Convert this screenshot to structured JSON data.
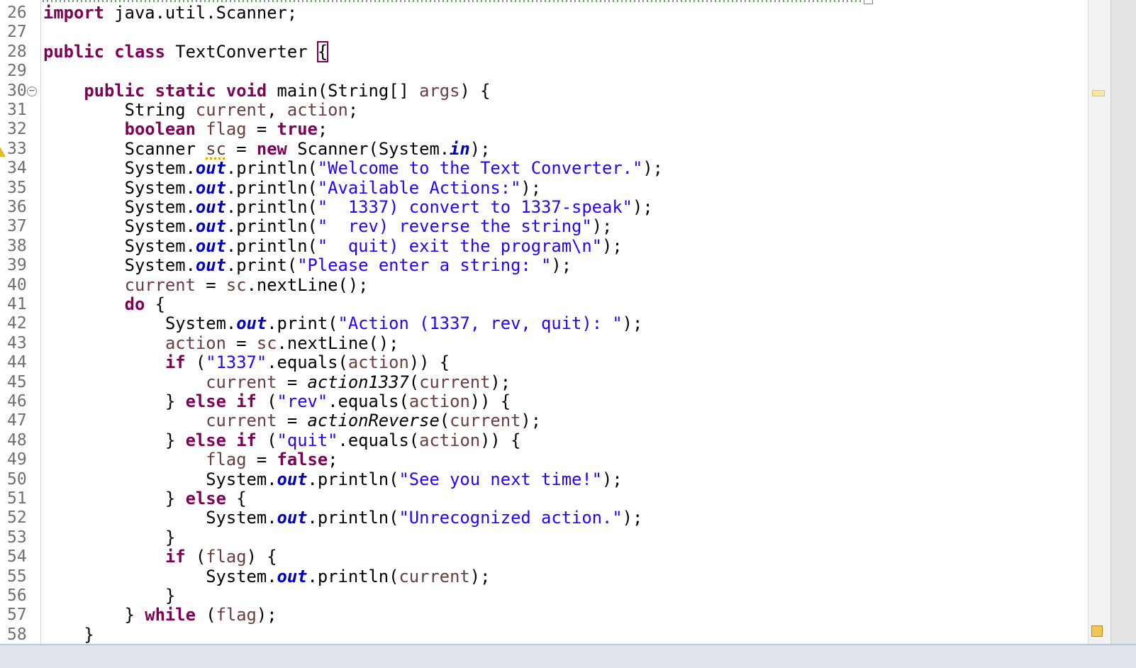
{
  "editor": {
    "line_numbers": [
      "26",
      "27",
      "28",
      "29",
      "30",
      "31",
      "32",
      "33",
      "34",
      "35",
      "36",
      "37",
      "38",
      "39",
      "40",
      "41",
      "42",
      "43",
      "44",
      "45",
      "46",
      "47",
      "48",
      "49",
      "50",
      "51",
      "52",
      "53",
      "54",
      "55",
      "56",
      "57",
      "58"
    ],
    "fold_glyph": "−",
    "code": {
      "l26": {
        "kw": "import",
        "rest": " java.util.Scanner;"
      },
      "l28": {
        "kw1": "public",
        "kw2": "class",
        "name": " TextConverter ",
        "brace": "{"
      },
      "l30": {
        "indent": "    ",
        "kw1": "public",
        "kw2": "static",
        "kw3": "void",
        "sig": " main(String[] ",
        "param": "args",
        "end": ") {"
      },
      "l31": {
        "indent": "        ",
        "type": "String ",
        "v1": "current",
        "comma": ", ",
        "v2": "action",
        "end": ";"
      },
      "l32": {
        "indent": "        ",
        "kw": "boolean",
        "sp": " ",
        "var": "flag",
        "eq": " = ",
        "val": "true",
        "end": ";"
      },
      "l33": {
        "indent": "        ",
        "type": "Scanner ",
        "var": "sc",
        "eq": " = ",
        "kw": "new",
        "call": " Scanner(System.",
        "fld": "in",
        "end": ");"
      },
      "l34": {
        "indent": "        ",
        "obj": "System.",
        "fld": "out",
        "method": ".println(",
        "str": "\"Welcome to the Text Converter.\"",
        "end": ");"
      },
      "l35": {
        "indent": "        ",
        "obj": "System.",
        "fld": "out",
        "method": ".println(",
        "str": "\"Available Actions:\"",
        "end": ");"
      },
      "l36": {
        "indent": "        ",
        "obj": "System.",
        "fld": "out",
        "method": ".println(",
        "str": "\"  1337) convert to 1337-speak\"",
        "end": ");"
      },
      "l37": {
        "indent": "        ",
        "obj": "System.",
        "fld": "out",
        "method": ".println(",
        "str": "\"  rev) reverse the string\"",
        "end": ");"
      },
      "l38": {
        "indent": "        ",
        "obj": "System.",
        "fld": "out",
        "method": ".println(",
        "str": "\"  quit) exit the program\\n\"",
        "end": ");"
      },
      "l39": {
        "indent": "        ",
        "obj": "System.",
        "fld": "out",
        "method": ".print(",
        "str": "\"Please enter a string: \"",
        "end": ");"
      },
      "l40": {
        "indent": "        ",
        "var": "current",
        "eq": " = ",
        "var2": "sc",
        "call": ".nextLine();"
      },
      "l41": {
        "indent": "        ",
        "kw": "do",
        "end": " {"
      },
      "l42": {
        "indent": "            ",
        "obj": "System.",
        "fld": "out",
        "method": ".print(",
        "str": "\"Action (1337, rev, quit): \"",
        "end": ");"
      },
      "l43": {
        "indent": "            ",
        "var": "action",
        "eq": " = ",
        "var2": "sc",
        "call": ".nextLine();"
      },
      "l44": {
        "indent": "            ",
        "kw": "if",
        "open": " (",
        "str": "\"1337\"",
        "call": ".equals(",
        "var": "action",
        "end": ")) {"
      },
      "l45": {
        "indent": "                ",
        "var": "current",
        "eq": " = ",
        "method": "action1337",
        "open": "(",
        "var2": "current",
        "end": ");"
      },
      "l46": {
        "indent": "            ",
        "close": "} ",
        "kw1": "else",
        "sp": " ",
        "kw2": "if",
        "open": " (",
        "str": "\"rev\"",
        "call": ".equals(",
        "var": "action",
        "end": ")) {"
      },
      "l47": {
        "indent": "                ",
        "var": "current",
        "eq": " = ",
        "method": "actionReverse",
        "open": "(",
        "var2": "current",
        "end": ");"
      },
      "l48": {
        "indent": "            ",
        "close": "} ",
        "kw1": "else",
        "sp": " ",
        "kw2": "if",
        "open": " (",
        "str": "\"quit\"",
        "call": ".equals(",
        "var": "action",
        "end": ")) {"
      },
      "l49": {
        "indent": "                ",
        "var": "flag",
        "eq": " = ",
        "val": "false",
        "end": ";"
      },
      "l50": {
        "indent": "                ",
        "obj": "System.",
        "fld": "out",
        "method": ".println(",
        "str": "\"See you next time!\"",
        "end": ");"
      },
      "l51": {
        "indent": "            ",
        "close": "} ",
        "kw": "else",
        "end": " {"
      },
      "l52": {
        "indent": "                ",
        "obj": "System.",
        "fld": "out",
        "method": ".println(",
        "str": "\"Unrecognized action.\"",
        "end": ");"
      },
      "l53": {
        "indent": "            ",
        "close": "}"
      },
      "l54": {
        "indent": "            ",
        "kw": "if",
        "open": " (",
        "var": "flag",
        "end": ") {"
      },
      "l55": {
        "indent": "                ",
        "obj": "System.",
        "fld": "out",
        "method": ".println(",
        "var": "current",
        "end": ");"
      },
      "l56": {
        "indent": "            ",
        "close": "}"
      },
      "l57": {
        "indent": "        ",
        "close": "} ",
        "kw": "while",
        "open": " (",
        "var": "flag",
        "end": ");"
      },
      "l58": {
        "indent": "    ",
        "close": "}"
      }
    }
  },
  "colors": {
    "keyword": "#7f0055",
    "string": "#2a00ff",
    "static_field": "#0000c0",
    "local_variable": "#6a3e3e",
    "line_number": "#6f6f6f",
    "warning": "#e8b82a"
  },
  "icons": [
    "fold-collapse-icon",
    "warning-icon"
  ]
}
